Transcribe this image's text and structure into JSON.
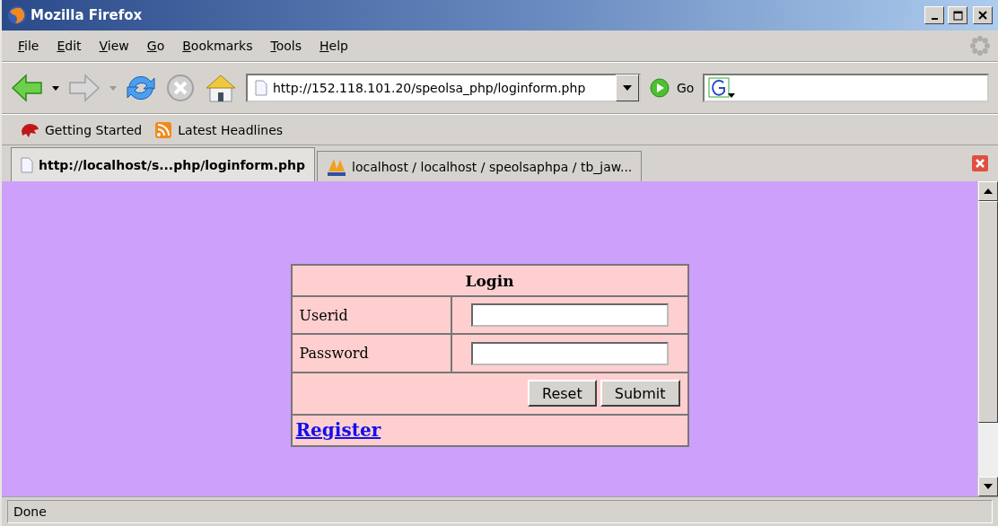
{
  "window": {
    "title": "Mozilla Firefox"
  },
  "menu": [
    "File",
    "Edit",
    "View",
    "Go",
    "Bookmarks",
    "Tools",
    "Help"
  ],
  "address": {
    "value": "http://152.118.101.20/speolsa_php/loginform.php"
  },
  "go_label": "Go",
  "bookmarks": [
    "Getting Started",
    "Latest Headlines"
  ],
  "tabs": [
    {
      "label": "http://localhost/s...php/loginform.php",
      "selected": true
    },
    {
      "label": "localhost / localhost / speolsaphpa / tb_jaw...",
      "selected": false
    }
  ],
  "login": {
    "title": "Login",
    "fields": [
      {
        "label": "Userid"
      },
      {
        "label": "Password"
      }
    ],
    "buttons": [
      "Reset",
      "Submit"
    ],
    "link": "Register"
  },
  "status_bar": "Done"
}
